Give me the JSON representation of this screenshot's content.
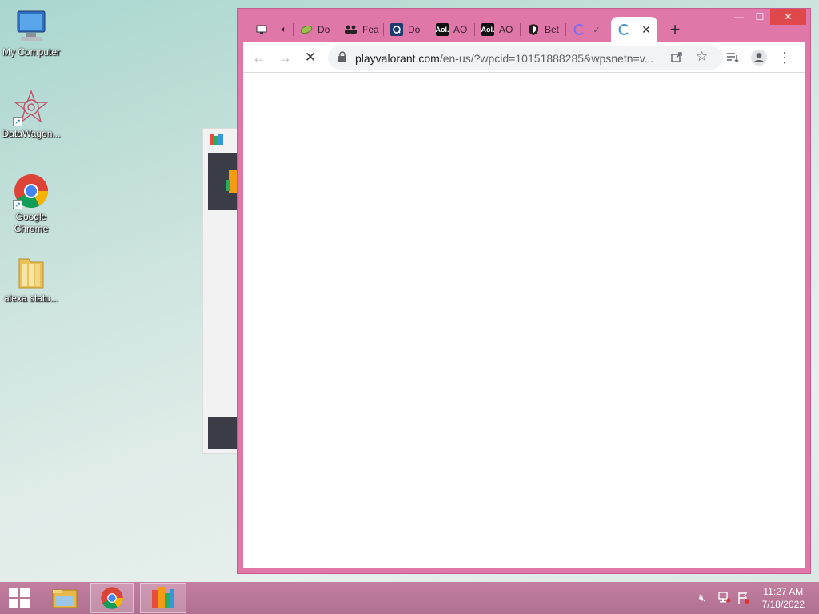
{
  "desktop": {
    "icons": [
      {
        "label": "My Computer",
        "icon": "computer-icon"
      },
      {
        "label": "DataWagon...",
        "icon": "datawagon-icon"
      },
      {
        "label": "Google Chrome",
        "icon": "chrome-icon"
      },
      {
        "label": "alexa statu...",
        "icon": "folder-icon"
      }
    ]
  },
  "browser": {
    "tabs": [
      {
        "title": "",
        "icon": "monitor-icon"
      },
      {
        "title": "",
        "icon": "speaker-icon"
      },
      {
        "title": "Do",
        "icon": "leaf-icon"
      },
      {
        "title": "Fea",
        "icon": "people-icon"
      },
      {
        "title": "Do",
        "icon": "search-q-icon"
      },
      {
        "title": "AO",
        "icon": "aol-icon"
      },
      {
        "title": "AO",
        "icon": "aol-icon"
      },
      {
        "title": "Bet",
        "icon": "shield-icon"
      },
      {
        "title": "",
        "icon": "loading-icon"
      },
      {
        "title": "",
        "icon": "loading-icon"
      }
    ],
    "url_main": "playvalorant.com",
    "url_rest": "/en-us/?wpcid=10151888285&wpsnetn=v...",
    "colors": {
      "frame": "#df77a8",
      "taskbar": "#b8779a"
    }
  },
  "taskbar": {
    "time": "11:27 AM",
    "date": "7/18/2022"
  }
}
